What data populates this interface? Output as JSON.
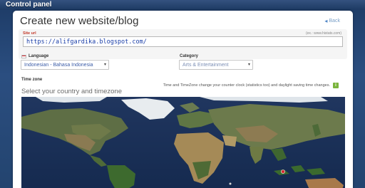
{
  "app": {
    "title": "Control panel"
  },
  "page": {
    "heading": "Create new website/blog",
    "back_label": "Back",
    "back_icon": "back-arrow-icon"
  },
  "site_url": {
    "label": "Site url",
    "example": "(ex.: www.histats.com)",
    "value": "https://alifgardika.blogspot.com/"
  },
  "language": {
    "label": "Language",
    "selected": "Indonesian - Bahasa Indonesia",
    "flag_icon": "indonesia-flag-icon"
  },
  "category": {
    "label": "Category",
    "selected": "Arts & Entertainment"
  },
  "timezone": {
    "label": "Time zone",
    "hint": "Time and TimeZone change your counter clock (statistics too) and daylight saving time changes.",
    "info_icon_text": "i",
    "select_prompt": "Select your country and timezone"
  },
  "colors": {
    "background": "#23446f",
    "panel": "#ffffff",
    "url_text": "#1a3ea8",
    "label_red": "#c33a2a",
    "map_ocean": "#1a2f56",
    "info_green": "#7ab43c"
  }
}
